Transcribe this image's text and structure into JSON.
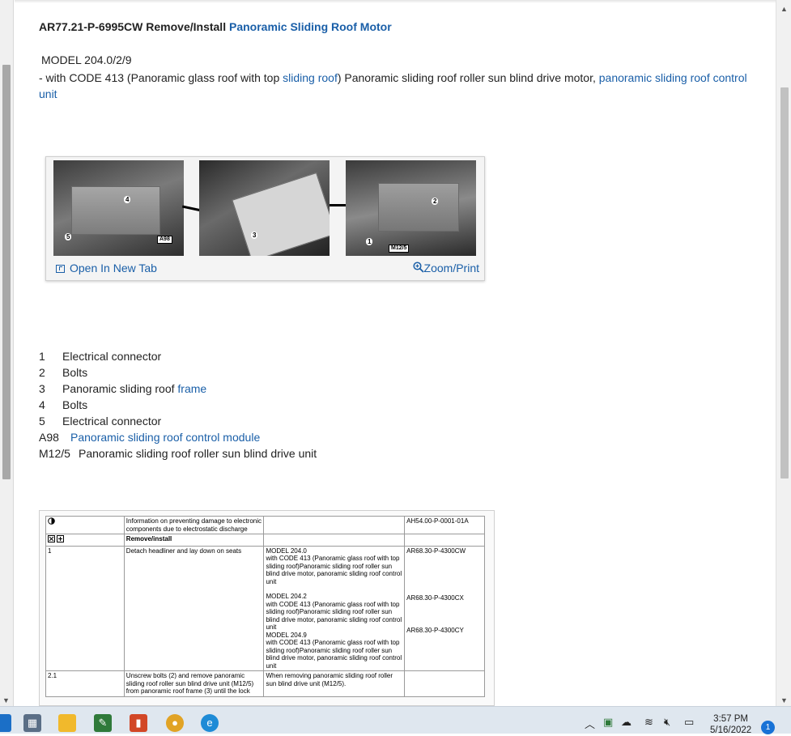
{
  "document": {
    "title_prefix": "AR77.21-P-6995CW Remove/Install",
    "title_link": "Panoramic Sliding Roof Motor",
    "model": "MODEL 204.0/2/9",
    "code_prefix": "-  with CODE 413 (Panoramic glass roof with top",
    "code_link1": "sliding roof",
    "code_mid": ") Panoramic sliding roof roller sun blind drive motor,",
    "code_link2": "panoramic sliding roof control unit"
  },
  "figure": {
    "open_tab_label": "Open In New Tab",
    "zoom_label": "Zoom/Print",
    "callouts": [
      "4",
      "5",
      "A98",
      "3",
      "2",
      "1",
      "M12/5"
    ]
  },
  "legend": [
    {
      "key": "1",
      "text": "Electrical connector",
      "link": ""
    },
    {
      "key": "2",
      "text": "Bolts",
      "link": ""
    },
    {
      "key": "3",
      "text": "Panoramic sliding roof",
      "link": "frame"
    },
    {
      "key": "4",
      "text": "Bolts",
      "link": ""
    },
    {
      "key": "5",
      "text": "Electrical connector",
      "link": ""
    },
    {
      "key": "A98",
      "text": "",
      "link": "Panoramic sliding roof control module"
    },
    {
      "key": "M12/5",
      "text": "Panoramic sliding roof roller sun blind drive unit",
      "link": ""
    }
  ],
  "table": {
    "row0": {
      "c2": "Information on preventing damage to electronic components due to electrostatic discharge",
      "c4": "AH54.00-P-0001-01A"
    },
    "row1": {
      "c2": "Remove/install"
    },
    "row2": {
      "c1": "1",
      "c2": "Detach headliner and lay down on seats",
      "m1_model": "MODEL 204.0",
      "m1_text": "with CODE 413 (Panoramic glass roof with top sliding roof)Panoramic sliding roof roller sun blind drive motor, panoramic sliding roof control unit",
      "m2_model": "MODEL 204.2",
      "m2_text": "with CODE 413 (Panoramic glass roof with top sliding roof)Panoramic sliding roof roller sun blind drive motor, panoramic sliding roof control unit",
      "m3_model": "MODEL 204.9",
      "m3_text": "with CODE 413 (Panoramic glass roof with top sliding roof)Panoramic sliding roof roller sun blind drive motor, panoramic sliding roof control unit",
      "r1": "AR68.30-P-4300CW",
      "r2": "AR68.30-P-4300CX",
      "r3": "AR68.30-P-4300CY"
    },
    "row3": {
      "c1": "2.1",
      "c2": "Unscrew bolts (2) and remove panoramic sliding roof roller sun blind drive unit (M12/5) from panoramic roof frame (3) until the lock",
      "c3": "When removing panoramic sliding roof roller sun blind drive unit (M12/5)."
    }
  },
  "taskbar": {
    "time": "3:57 PM",
    "date": "5/16/2022",
    "notification_count": "1"
  },
  "colors": {
    "link": "#1a5fa8",
    "taskbar": "#dfe7ef"
  }
}
